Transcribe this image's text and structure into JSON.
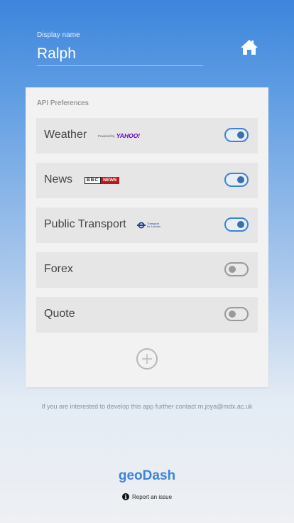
{
  "header": {
    "display_label": "Display name",
    "display_name": "Ralph"
  },
  "preferences": {
    "title": "API Preferences",
    "items": [
      {
        "label": "Weather",
        "logo_text": "Powered by",
        "logo_brand": "YAHOO!",
        "enabled": true
      },
      {
        "label": "News",
        "logo_text": "BBC",
        "logo_brand": "NEWS",
        "enabled": true
      },
      {
        "label": "Public Transport",
        "logo_text": "Transport",
        "logo_brand": "for London",
        "enabled": true
      },
      {
        "label": "Forex",
        "enabled": false
      },
      {
        "label": "Quote",
        "enabled": false
      }
    ]
  },
  "footer": {
    "contact": "If you are interested to develop this app further contact m.joya@mdx.ac.uk",
    "brand": "geoDash",
    "report": "Report an issue"
  },
  "colors": {
    "accent": "#3b84d8",
    "toggle_on_knob": "#3b6fb0",
    "toggle_off": "#9a9a9a",
    "bbc_news_red": "#bb1919",
    "yahoo_purple": "#5f01d1",
    "tfl_blue": "#1c3f94"
  },
  "icons": {
    "home": "home-icon",
    "add": "plus-circle-icon",
    "info": "info-icon"
  }
}
